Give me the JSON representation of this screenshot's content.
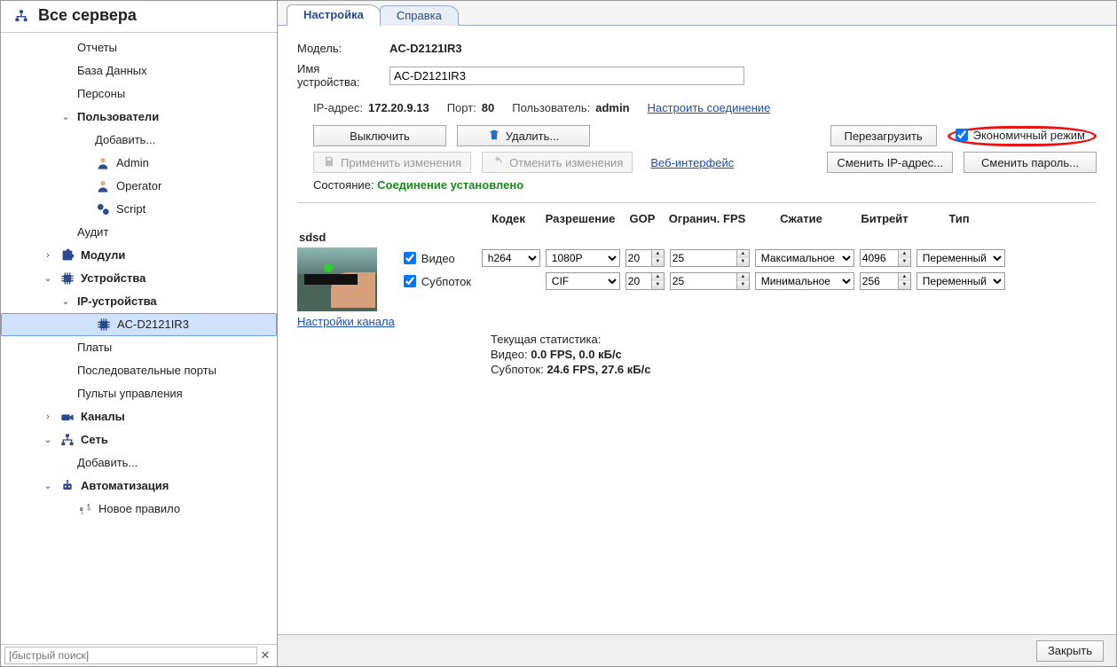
{
  "sidebar": {
    "title": "Все сервера",
    "items": [
      {
        "label": "Отчеты",
        "indent": "indent1"
      },
      {
        "label": "База Данных",
        "indent": "indent1"
      },
      {
        "label": "Персоны",
        "indent": "indent1"
      },
      {
        "label": "Пользователи",
        "indent": "indent1",
        "bold": true,
        "caret": "v"
      },
      {
        "label": "Добавить...",
        "indent": "indent2"
      },
      {
        "label": "Admin",
        "indent": "indent2",
        "icon": "user"
      },
      {
        "label": "Operator",
        "indent": "indent2",
        "icon": "user"
      },
      {
        "label": "Script",
        "indent": "indent2",
        "icon": "gears"
      },
      {
        "label": "Аудит",
        "indent": "indent1"
      },
      {
        "label": "Модули",
        "indent": "indent0",
        "bold": true,
        "caret": ">",
        "icon": "puzzle"
      },
      {
        "label": "Устройства",
        "indent": "indent0",
        "bold": true,
        "caret": "v",
        "icon": "chip"
      },
      {
        "label": "IP-устройства",
        "indent": "indent1",
        "bold": true,
        "caret": "v"
      },
      {
        "label": "AC-D2121IR3",
        "indent": "indent2",
        "selected": true,
        "icon": "chip"
      },
      {
        "label": "Платы",
        "indent": "indent1"
      },
      {
        "label": "Последовательные порты",
        "indent": "indent1"
      },
      {
        "label": "Пульты управления",
        "indent": "indent1"
      },
      {
        "label": "Каналы",
        "indent": "indent0",
        "bold": true,
        "caret": ">",
        "icon": "camera"
      },
      {
        "label": "Сеть",
        "indent": "indent0",
        "bold": true,
        "caret": "v",
        "icon": "network"
      },
      {
        "label": "Добавить...",
        "indent": "indent1"
      },
      {
        "label": "Автоматизация",
        "indent": "indent0",
        "bold": true,
        "caret": "v",
        "icon": "robot"
      },
      {
        "label": "Новое правило",
        "indent": "indent1",
        "icon": "python",
        "grey": true
      }
    ],
    "search_placeholder": "[быстрый поиск]"
  },
  "tabs": {
    "active": "Настройка",
    "other": "Справка"
  },
  "details": {
    "model_label": "Модель:",
    "model": "AC-D2121IR3",
    "name_label": "Имя устройства:",
    "name_value": "AC-D2121IR3",
    "ip_label": "IP-адрес:",
    "ip": "172.20.9.13",
    "port_label": "Порт:",
    "port": "80",
    "user_label": "Пользователь:",
    "user": "admin",
    "configure_link": "Настроить соединение",
    "buttons": {
      "off": "Выключить",
      "delete": "Удалить...",
      "reboot": "Перезагрузить",
      "eco": "Экономичный режим",
      "apply": "Применить изменения",
      "cancel": "Отменить изменения",
      "web": "Веб-интерфейс",
      "change_ip": "Сменить IP-адрес...",
      "change_pw": "Сменить пароль..."
    },
    "status_label": "Состояние:",
    "status": "Соединение установлено"
  },
  "streams": {
    "headers": {
      "codec": "Кодек",
      "res": "Разрешение",
      "gop": "GOP",
      "fps": "Огранич. FPS",
      "comp": "Сжатие",
      "bitrate": "Битрейт",
      "type": "Тип"
    },
    "channel_name": "sdsd",
    "channel_link": "Настройки канала",
    "rows": [
      {
        "enable": "Видео",
        "codec": "h264",
        "res": "1080P",
        "gop": "20",
        "fps": "25",
        "comp": "Максимальное",
        "bitrate": "4096",
        "type": "Переменный"
      },
      {
        "enable": "Субпоток",
        "codec": "",
        "res": "CIF",
        "gop": "20",
        "fps": "25",
        "comp": "Минимальное",
        "bitrate": "256",
        "type": "Переменный"
      }
    ],
    "stats": {
      "title": "Текущая статистика:",
      "video_lbl": "Видео:",
      "video_val": "0.0 FPS, 0.0 кБ/с",
      "sub_lbl": "Субпоток:",
      "sub_val": "24.6 FPS, 27.6 кБ/с"
    }
  },
  "footer": {
    "close": "Закрыть"
  }
}
